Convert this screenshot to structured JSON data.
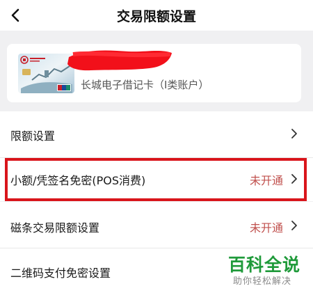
{
  "header": {
    "title": "交易限额设置",
    "back_icon": "chevron-left-icon"
  },
  "card": {
    "name": "长城电子借记卡（I类账户）"
  },
  "rows": [
    {
      "label": "限额设置",
      "status": ""
    },
    {
      "label": "小额/凭签名免密(POS消费)",
      "status": "未开通"
    },
    {
      "label": "磁条交易限额设置",
      "status": "未开通"
    },
    {
      "label": "二维码支付免密设置",
      "status": ""
    }
  ],
  "watermark": {
    "main": "百科全说",
    "sub": "助你轻松解决"
  },
  "colors": {
    "highlight": "#d9151b",
    "status": "#c0504d",
    "redaction": "#f2101a",
    "watermark_green": "#1f9a3a"
  }
}
